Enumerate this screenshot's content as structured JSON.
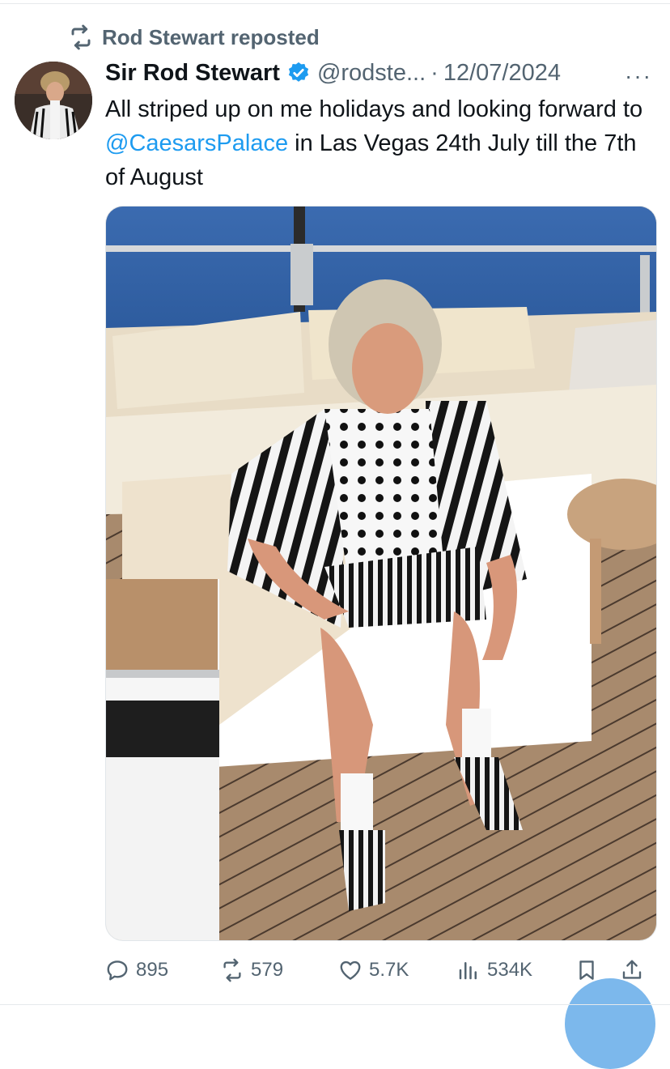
{
  "repost": {
    "label": "Rod Stewart reposted"
  },
  "tweet": {
    "display_name": "Sir Rod Stewart",
    "handle": "@rodste...",
    "separator": "·",
    "date": "12/07/2024",
    "more": "···",
    "text_before": "All striped up on me holidays and looking forward to ",
    "mention": "@CaesarsPalace",
    "text_after": " in Las Vegas 24th July till the 7th of August",
    "media_description": "Photo of a man in a black-and-white striped jacket and polka-dot shirt sitting on a yacht deck"
  },
  "actions": {
    "replies": "895",
    "reposts": "579",
    "likes": "5.7K",
    "views": "534K"
  },
  "colors": {
    "accent": "#1d9bf0",
    "muted": "#536471",
    "text": "#0f1419"
  },
  "icons": [
    "repost-icon",
    "verified-badge-icon",
    "more-icon",
    "reply-icon",
    "like-icon",
    "views-icon",
    "bookmark-icon",
    "share-icon"
  ]
}
